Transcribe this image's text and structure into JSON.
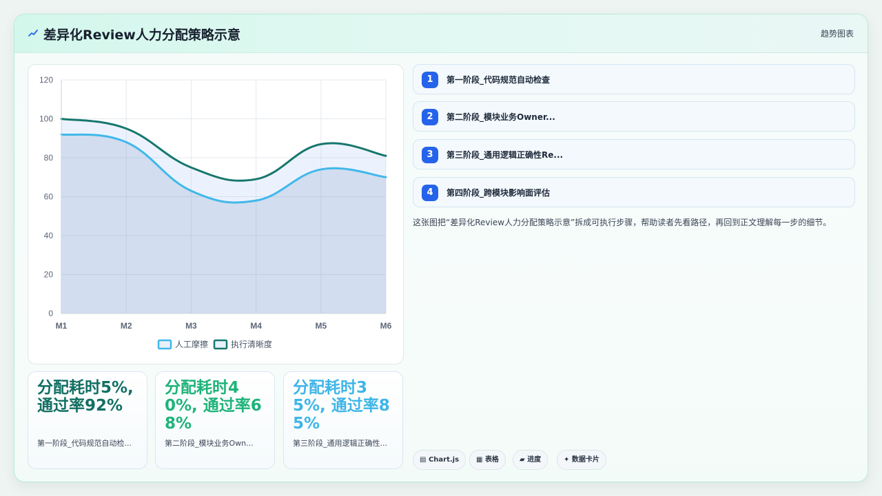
{
  "header": {
    "icon": "chart-line-icon",
    "title": "差异化Review人力分配策略示意",
    "tag": "趋势图表"
  },
  "chart_data": {
    "type": "area",
    "categories": [
      "M1",
      "M2",
      "M3",
      "M4",
      "M5",
      "M6"
    ],
    "series": [
      {
        "name": "人工摩擦",
        "values": [
          92,
          88,
          63,
          58,
          74,
          70
        ],
        "color": "#40b8ea"
      },
      {
        "name": "执行清晰度",
        "values": [
          100,
          95,
          75,
          69,
          87,
          81
        ],
        "color": "#16776d"
      }
    ],
    "ylim": [
      0,
      120
    ],
    "yticks": [
      0,
      20,
      40,
      60,
      80,
      100,
      120
    ],
    "grid": true,
    "legend": "bottom"
  },
  "stats": [
    {
      "value": "分配耗时5%, 通过率92%",
      "caption": "第一阶段_代码规范自动检...",
      "color": "#136f63"
    },
    {
      "value": "分配耗时40%, 通过率68%",
      "caption": "第二阶段_模块业务Own...",
      "color": "#1fb37a"
    },
    {
      "value": "分配耗时35%, 通过率85%",
      "caption": "第三阶段_通用逻辑正确性...",
      "color": "#3fb5e7"
    }
  ],
  "steps": [
    {
      "num": "1",
      "label": "第一阶段_代码规范自动检查"
    },
    {
      "num": "2",
      "label": "第二阶段_模块业务Owner..."
    },
    {
      "num": "3",
      "label": "第三阶段_通用逻辑正确性Re..."
    },
    {
      "num": "4",
      "label": "第四阶段_跨模块影响面评估"
    }
  ],
  "description": "这张图把“差异化Review人力分配策略示意”拆成可执行步骤，帮助读者先看路径，再回到正文理解每一步的细节。",
  "chips": [
    {
      "icon": "▤",
      "label": "Chart.js"
    },
    {
      "icon": "▦",
      "label": "表格"
    },
    {
      "icon": "▰",
      "label": "进度"
    },
    {
      "icon": "✦",
      "label": "数据卡片"
    }
  ]
}
